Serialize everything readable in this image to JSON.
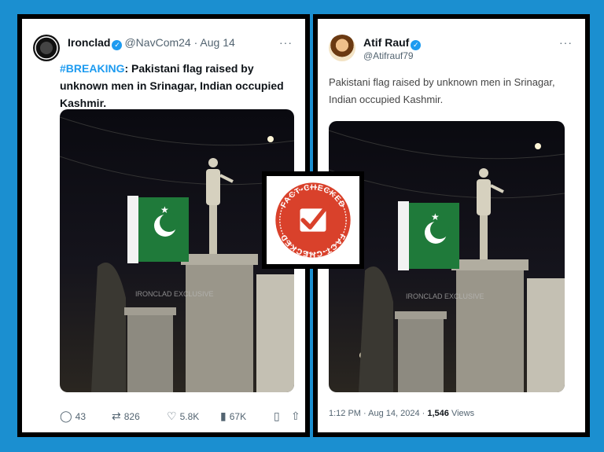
{
  "left_tweet": {
    "name": "Ironclad",
    "handle": "@NavCom24",
    "date": "· Aug 14",
    "more": "···",
    "hashtag": "#BREAKING",
    "text": ": Pakistani flag raised by unknown men in Srinagar, Indian occupied Kashmir.",
    "watermark": "IRONCLAD EXCLUSIVE",
    "actions": {
      "replies": "43",
      "reposts": "826",
      "likes": "5.8K",
      "views": "67K"
    }
  },
  "right_tweet": {
    "name": "Atif Rauf",
    "handle": "@Atifrauf79",
    "more": "···",
    "text": "Pakistani flag raised by unknown men in Srinagar, Indian occupied Kashmir.",
    "watermark": "IRONCLAD EXCLUSIVE",
    "time": "1:12 PM · Aug 14, 2024 · ",
    "views_count": "1,546",
    "views_label": " Views"
  },
  "stamp": {
    "text": "FACT-CHECKED",
    "color": "#d9412b"
  },
  "icons": {
    "reply": "reply-icon",
    "repost": "repost-icon",
    "like": "like-icon",
    "views": "views-icon",
    "bookmark": "bookmark-icon",
    "share": "share-icon",
    "verified": "verified-badge-icon"
  },
  "colors": {
    "background": "#1b8fd0",
    "link": "#1d9bf0",
    "flag_green": "#1f7a3a"
  }
}
